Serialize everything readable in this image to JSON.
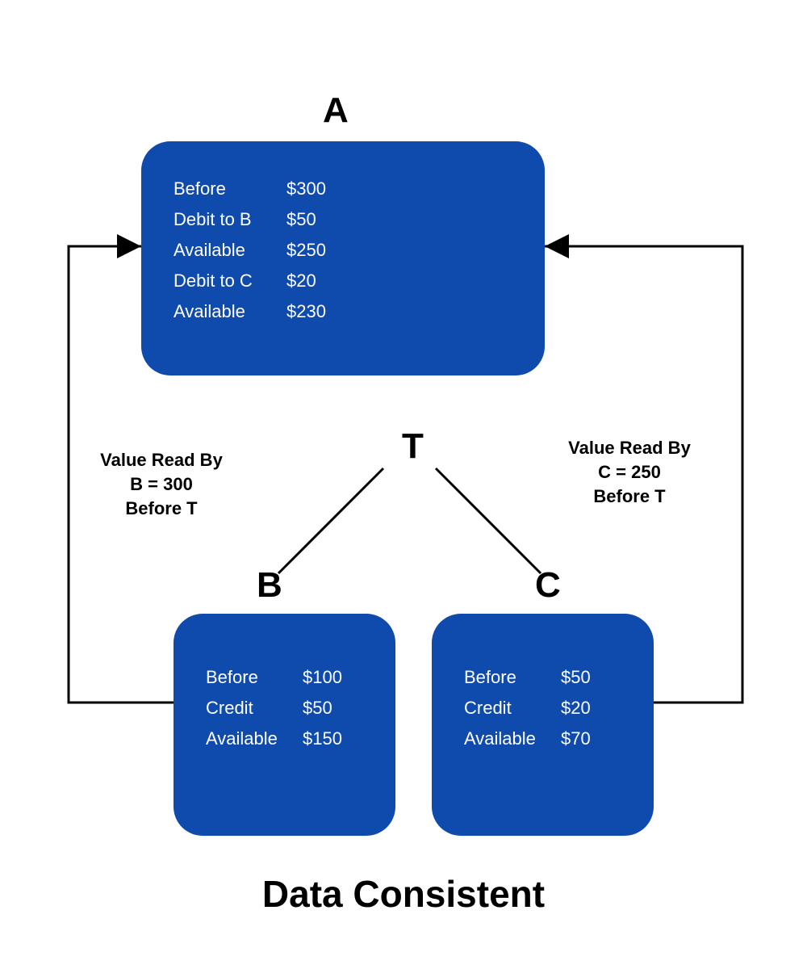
{
  "title": "Data Consistent",
  "labels": {
    "A": "A",
    "B": "B",
    "C": "C",
    "T": "T"
  },
  "sideLeft": {
    "l1": "Value Read By",
    "l2": "B = 300",
    "l3": "Before T"
  },
  "sideRight": {
    "l1": "Value Read By",
    "l2": "C = 250",
    "l3": "Before T"
  },
  "nodeA": {
    "r1": {
      "lab": "Before",
      "val": "$300"
    },
    "r2": {
      "lab": "Debit to B",
      "val": "$50"
    },
    "r3": {
      "lab": "Available",
      "val": "$250"
    },
    "r4": {
      "lab": "Debit to C",
      "val": "$20"
    },
    "r5": {
      "lab": "Available",
      "val": "$230"
    }
  },
  "nodeB": {
    "r1": {
      "lab": "Before",
      "val": "$100"
    },
    "r2": {
      "lab": "Credit",
      "val": "$50"
    },
    "r3": {
      "lab": "Available",
      "val": "$150"
    }
  },
  "nodeC": {
    "r1": {
      "lab": "Before",
      "val": "$50"
    },
    "r2": {
      "lab": "Credit",
      "val": "$20"
    },
    "r3": {
      "lab": "Available",
      "val": "$70"
    }
  }
}
